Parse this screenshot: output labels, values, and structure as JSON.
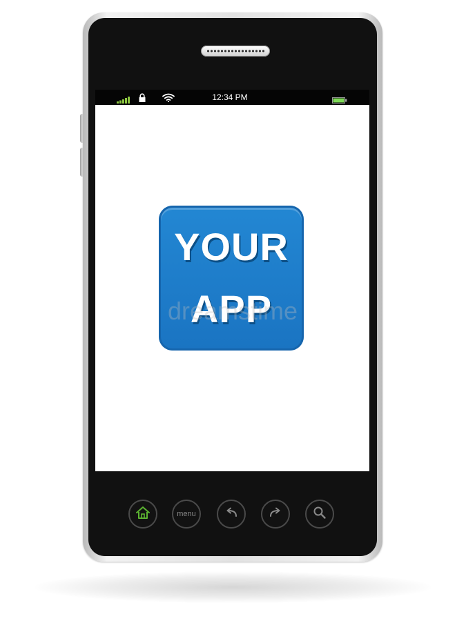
{
  "status_bar": {
    "time": "12:34 PM",
    "icons": [
      "signal-bars-icon",
      "lock-icon",
      "wifi-icon",
      "battery-icon"
    ],
    "signal_color": "#8cc63f",
    "battery_color": "#7ed957"
  },
  "app_icon": {
    "line1": "YOUR",
    "line2": "APP",
    "color": "#1f7fcf"
  },
  "watermark": "dreamstime",
  "nav_buttons": {
    "home_icon": "home-icon",
    "home_color": "#5cb531",
    "menu_label": "menu",
    "back_icon": "back-arrow-icon",
    "forward_icon": "forward-arrow-icon",
    "search_icon": "search-icon"
  }
}
